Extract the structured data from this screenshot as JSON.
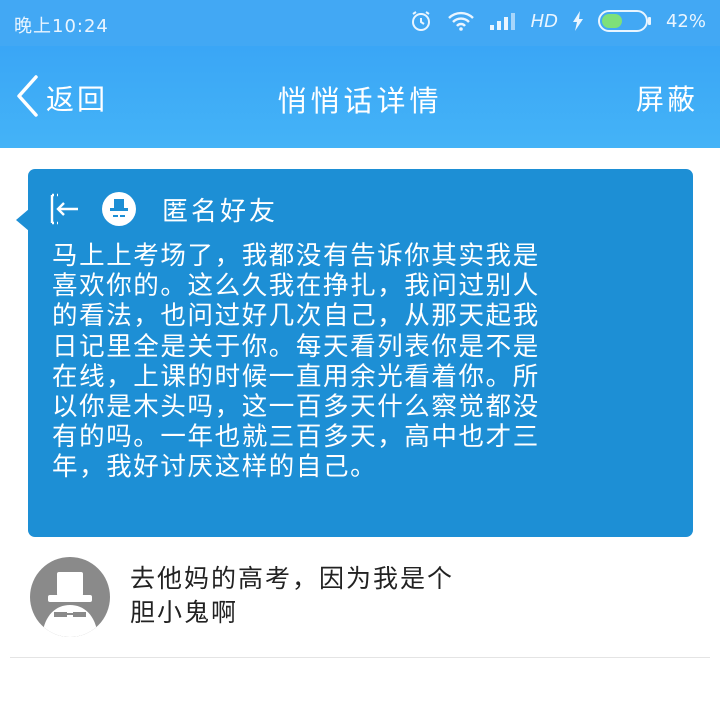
{
  "status": {
    "time": "晚上10:24",
    "network": "HD",
    "battery": "42%",
    "icons": [
      "alarm-icon",
      "wifi-icon",
      "signal-icon",
      "charging-icon",
      "battery-icon"
    ]
  },
  "header": {
    "back_label": "返回",
    "title": "悄悄话详情",
    "block_label": "屏蔽"
  },
  "message": {
    "sender": "匿名好友",
    "lines": [
      "马上上考场了，我都没有告诉你其实我是",
      "喜欢你的。这么久我在挣扎，我问过别人",
      "的看法，也问过好几次自己，从那天起我",
      "日记里全是关于你。每天看列表你是不是",
      "在线，上课的时候一直用余光看着你。所",
      "以你是木头吗，这一百多天什么察觉都没",
      "有的吗。一年也就三百多天，高中也才三",
      "年，我好讨厌这样的自己。"
    ]
  },
  "reply": {
    "lines": [
      "去他妈的高考，因为我是个",
      "胆小鬼啊"
    ]
  },
  "colors": {
    "header_bg": "#3aa6f6",
    "card_bg": "#1d8fd5",
    "avatar_bg": "#8a8a8a"
  }
}
